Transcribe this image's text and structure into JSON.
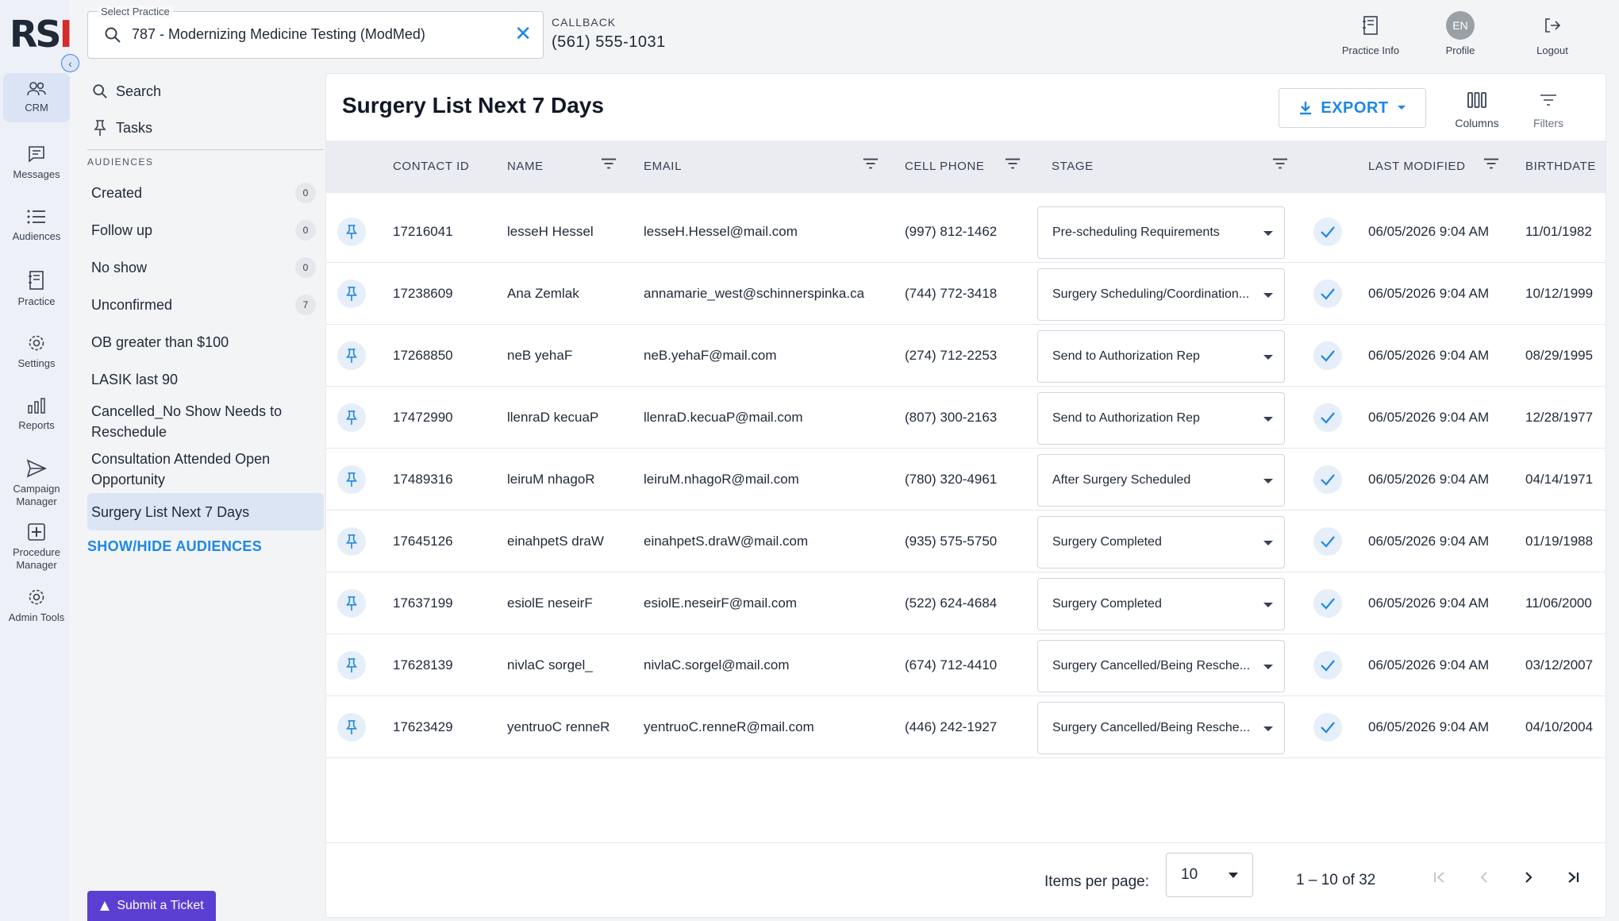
{
  "brand": {
    "logo_pre": "RS",
    "logo_accent": "I"
  },
  "rail": {
    "items": [
      {
        "label": "CRM"
      },
      {
        "label": "Messages"
      },
      {
        "label": "Audiences"
      },
      {
        "label": "Practice"
      },
      {
        "label": "Settings"
      },
      {
        "label": "Reports"
      },
      {
        "label": "Campaign Manager"
      },
      {
        "label": "Procedure Manager"
      },
      {
        "label": "Admin Tools"
      }
    ]
  },
  "practice_select": {
    "label": "Select Practice",
    "value": "787 - Modernizing Medicine Testing (ModMed)"
  },
  "callback": {
    "title": "CALLBACK",
    "number": "(561) 555-1031"
  },
  "top_actions": {
    "practice_info": "Practice Info",
    "profile": "Profile",
    "profile_initials": "EN",
    "logout": "Logout"
  },
  "nav": {
    "search": "Search",
    "tasks": "Tasks"
  },
  "audiences": {
    "heading": "AUDIENCES",
    "items": [
      {
        "label": "Created",
        "count": "0"
      },
      {
        "label": "Follow up",
        "count": "0"
      },
      {
        "label": "No show",
        "count": "0"
      },
      {
        "label": "Unconfirmed",
        "count": "7"
      },
      {
        "label": "OB greater than $100"
      },
      {
        "label": "LASIK last 90"
      },
      {
        "label": "Cancelled_No Show Needs to Reschedule"
      },
      {
        "label": "Consultation Attended Open Opportunity"
      },
      {
        "label": "Surgery List Next 7 Days",
        "active": true
      }
    ],
    "show_hide": "SHOW/HIDE AUDIENCES",
    "submit_ticket": "Submit a Ticket"
  },
  "main": {
    "title": "Surgery List Next 7 Days",
    "export_label": "EXPORT",
    "columns_label": "Columns",
    "filters_label": "Filters"
  },
  "table": {
    "headers": {
      "contact_id": "CONTACT ID",
      "name": "NAME",
      "email": "EMAIL",
      "cell_phone": "CELL PHONE",
      "stage": "STAGE",
      "last_modified": "LAST MODIFIED",
      "birthdate": "BIRTHDATE"
    },
    "rows": [
      {
        "contact_id": "17216041",
        "name": "lesseH Hessel",
        "email": "lesseH.Hessel@mail.com",
        "cell_phone": "(997) 812-1462",
        "stage": "Pre-scheduling Requirements",
        "last_modified": "06/05/2026 9:04 AM",
        "birthdate": "11/01/1982"
      },
      {
        "contact_id": "17238609",
        "name": "Ana Zemlak",
        "email": "annamarie_west@schinnerspinka.ca",
        "cell_phone": "(744) 772-3418",
        "stage": "Surgery Scheduling/Coordination...",
        "last_modified": "06/05/2026 9:04 AM",
        "birthdate": "10/12/1999"
      },
      {
        "contact_id": "17268850",
        "name": "neB yehaF",
        "email": "neB.yehaF@mail.com",
        "cell_phone": "(274) 712-2253",
        "stage": "Send to Authorization Rep",
        "last_modified": "06/05/2026 9:04 AM",
        "birthdate": "08/29/1995"
      },
      {
        "contact_id": "17472990",
        "name": "llenraD kecuaP",
        "email": "llenraD.kecuaP@mail.com",
        "cell_phone": "(807) 300-2163",
        "stage": "Send to Authorization Rep",
        "last_modified": "06/05/2026 9:04 AM",
        "birthdate": "12/28/1977"
      },
      {
        "contact_id": "17489316",
        "name": "leiruM nhagoR",
        "email": "leiruM.nhagoR@mail.com",
        "cell_phone": "(780) 320-4961",
        "stage": "After Surgery Scheduled",
        "last_modified": "06/05/2026 9:04 AM",
        "birthdate": "04/14/1971"
      },
      {
        "contact_id": "17645126",
        "name": "einahpetS draW",
        "email": "einahpetS.draW@mail.com",
        "cell_phone": "(935) 575-5750",
        "stage": "Surgery Completed",
        "last_modified": "06/05/2026 9:04 AM",
        "birthdate": "01/19/1988"
      },
      {
        "contact_id": "17637199",
        "name": "esiolE neseirF",
        "email": "esiolE.neseirF@mail.com",
        "cell_phone": "(522) 624-4684",
        "stage": "Surgery Completed",
        "last_modified": "06/05/2026 9:04 AM",
        "birthdate": "11/06/2000"
      },
      {
        "contact_id": "17628139",
        "name": "nivlaC sorgel_",
        "email": "nivlaC.sorgel@mail.com",
        "cell_phone": "(674) 712-4410",
        "stage": "Surgery Cancelled/Being Resche...",
        "last_modified": "06/05/2026 9:04 AM",
        "birthdate": "03/12/2007"
      },
      {
        "contact_id": "17623429",
        "name": "yentruoC renneR",
        "email": "yentruoC.renneR@mail.com",
        "cell_phone": "(446) 242-1927",
        "stage": "Surgery Cancelled/Being Resche...",
        "last_modified": "06/05/2026 9:04 AM",
        "birthdate": "04/10/2004"
      }
    ]
  },
  "pagination": {
    "items_per_page_label": "Items per page:",
    "items_per_page": "10",
    "range": "1 – 10 of 32"
  },
  "colors": {
    "accent": "#1e88e5",
    "ticket": "#5b3fd3",
    "logo_red": "#d42b2b"
  }
}
